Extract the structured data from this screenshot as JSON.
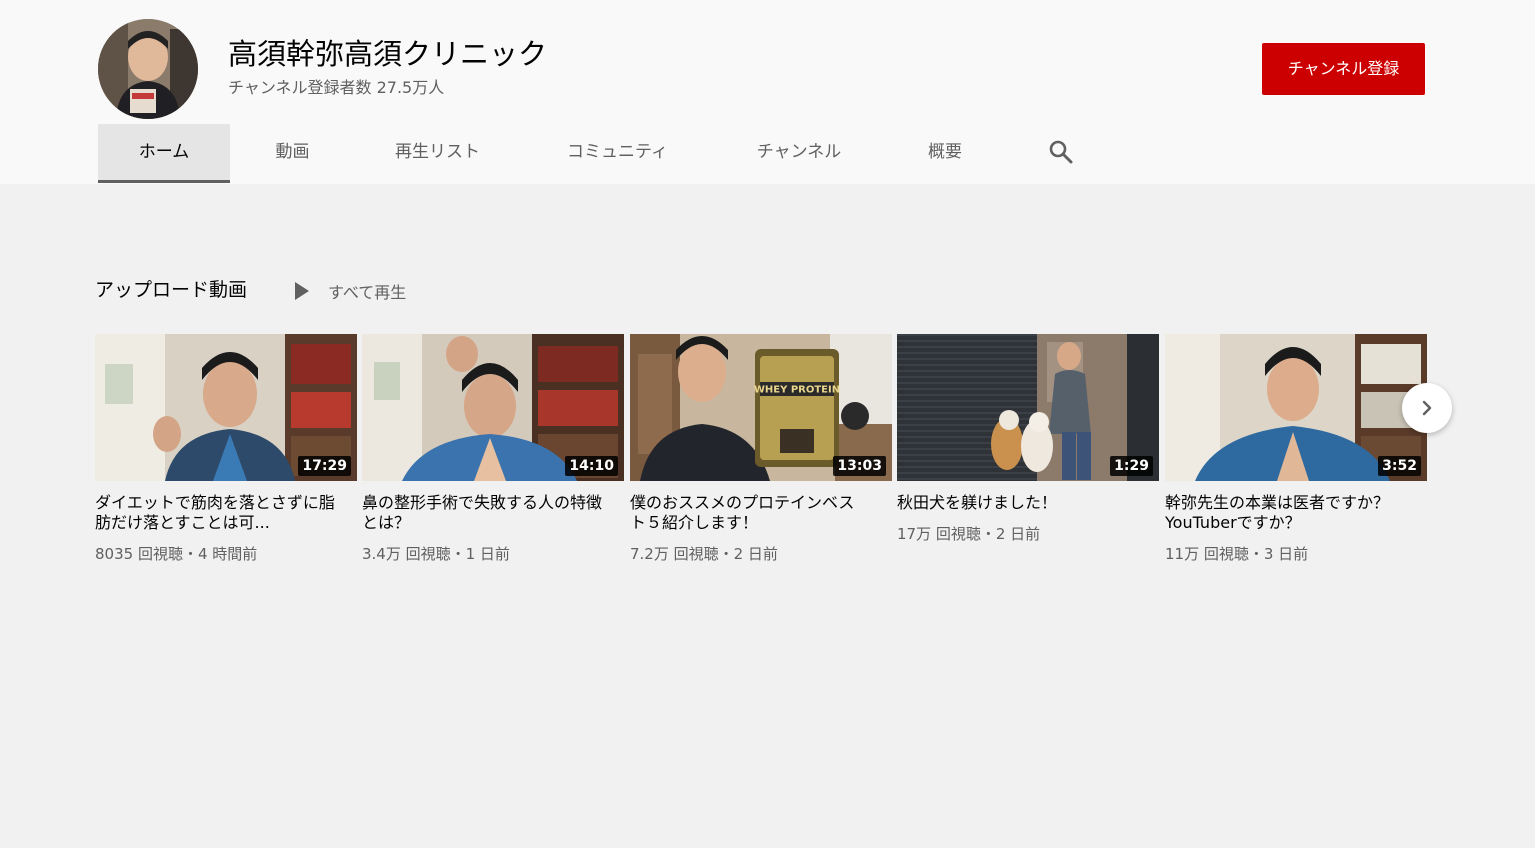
{
  "channel": {
    "name": "高須幹弥高須クリニック",
    "subscribers": "チャンネル登録者数 27.5万人",
    "subscribe_label": "チャンネル登録"
  },
  "tabs": [
    {
      "label": "ホーム",
      "active": true
    },
    {
      "label": "動画",
      "active": false
    },
    {
      "label": "再生リスト",
      "active": false
    },
    {
      "label": "コミュニティ",
      "active": false
    },
    {
      "label": "チャンネル",
      "active": false
    },
    {
      "label": "概要",
      "active": false
    }
  ],
  "search_icon": "search-icon",
  "section": {
    "title": "アップロード動画",
    "play_all": "すべて再生"
  },
  "videos": [
    {
      "title": "ダイエットで筋肉を落とさずに脂肪だけ落とすことは可...",
      "meta": "8035 回視聴・4 時間前",
      "duration": "17:29"
    },
    {
      "title": "鼻の整形手術で失敗する人の特徴とは？",
      "meta": "3.4万 回視聴・1 日前",
      "duration": "14:10"
    },
    {
      "title": "僕のおススメのプロテインベスト５紹介します！",
      "meta": "7.2万 回視聴・2 日前",
      "duration": "13:03"
    },
    {
      "title": "秋田犬を躾けました！",
      "meta": "17万 回視聴・2 日前",
      "duration": "1:29"
    },
    {
      "title": "幹弥先生の本業は医者ですか？YouTuberですか？",
      "meta": "11万 回視聴・3 日前",
      "duration": "3:52"
    }
  ],
  "thumbnail_texts": {
    "protein_label": "WHEY PROTEIN"
  },
  "colors": {
    "subscribe": "#cc0000",
    "header_bg": "#f9f9f9",
    "page_bg": "#f1f1f1"
  }
}
